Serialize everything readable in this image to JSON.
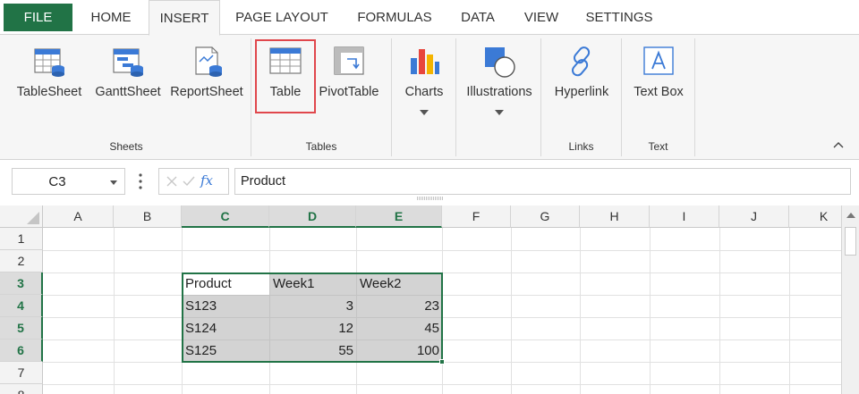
{
  "tabs": [
    {
      "label": "FILE"
    },
    {
      "label": "HOME"
    },
    {
      "label": "INSERT"
    },
    {
      "label": "PAGE LAYOUT"
    },
    {
      "label": "FORMULAS"
    },
    {
      "label": "DATA"
    },
    {
      "label": "VIEW"
    },
    {
      "label": "SETTINGS"
    }
  ],
  "ribbon": {
    "buttons": [
      {
        "label": "TableSheet",
        "icon": "tablesheet-icon"
      },
      {
        "label": "GanttSheet",
        "icon": "ganttsheet-icon"
      },
      {
        "label": "ReportSheet",
        "icon": "reportsheet-icon"
      },
      {
        "label": "Table",
        "icon": "table-icon"
      },
      {
        "label": "PivotTable",
        "icon": "pivottable-icon"
      },
      {
        "label": "Charts",
        "icon": "charts-icon"
      },
      {
        "label": "Illustrations",
        "icon": "illustrations-icon"
      },
      {
        "label": "Hyperlink",
        "icon": "hyperlink-icon"
      },
      {
        "label": "Text Box",
        "icon": "textbox-icon"
      }
    ],
    "groups": [
      {
        "label": "Sheets"
      },
      {
        "label": "Tables"
      },
      {
        "label": "Links"
      },
      {
        "label": "Text"
      }
    ]
  },
  "formula_bar": {
    "name_box": "C3",
    "fx": "fx",
    "formula": "Product"
  },
  "grid": {
    "columns": [
      "A",
      "B",
      "C",
      "D",
      "E",
      "F",
      "G",
      "H",
      "I",
      "J",
      "K"
    ],
    "rows": [
      "1",
      "2",
      "3",
      "4",
      "5",
      "6",
      "7",
      "8"
    ],
    "cells": {
      "C3": "Product",
      "D3": "Week1",
      "E3": "Week2",
      "C4": "S123",
      "D4": "3",
      "E4": "23",
      "C5": "S124",
      "D5": "12",
      "E5": "45",
      "C6": "S125",
      "D6": "55",
      "E6": "100"
    }
  },
  "colors": {
    "accent": "#217346",
    "highlight": "#e0474c",
    "selection_fill": "#d3d3d3"
  }
}
